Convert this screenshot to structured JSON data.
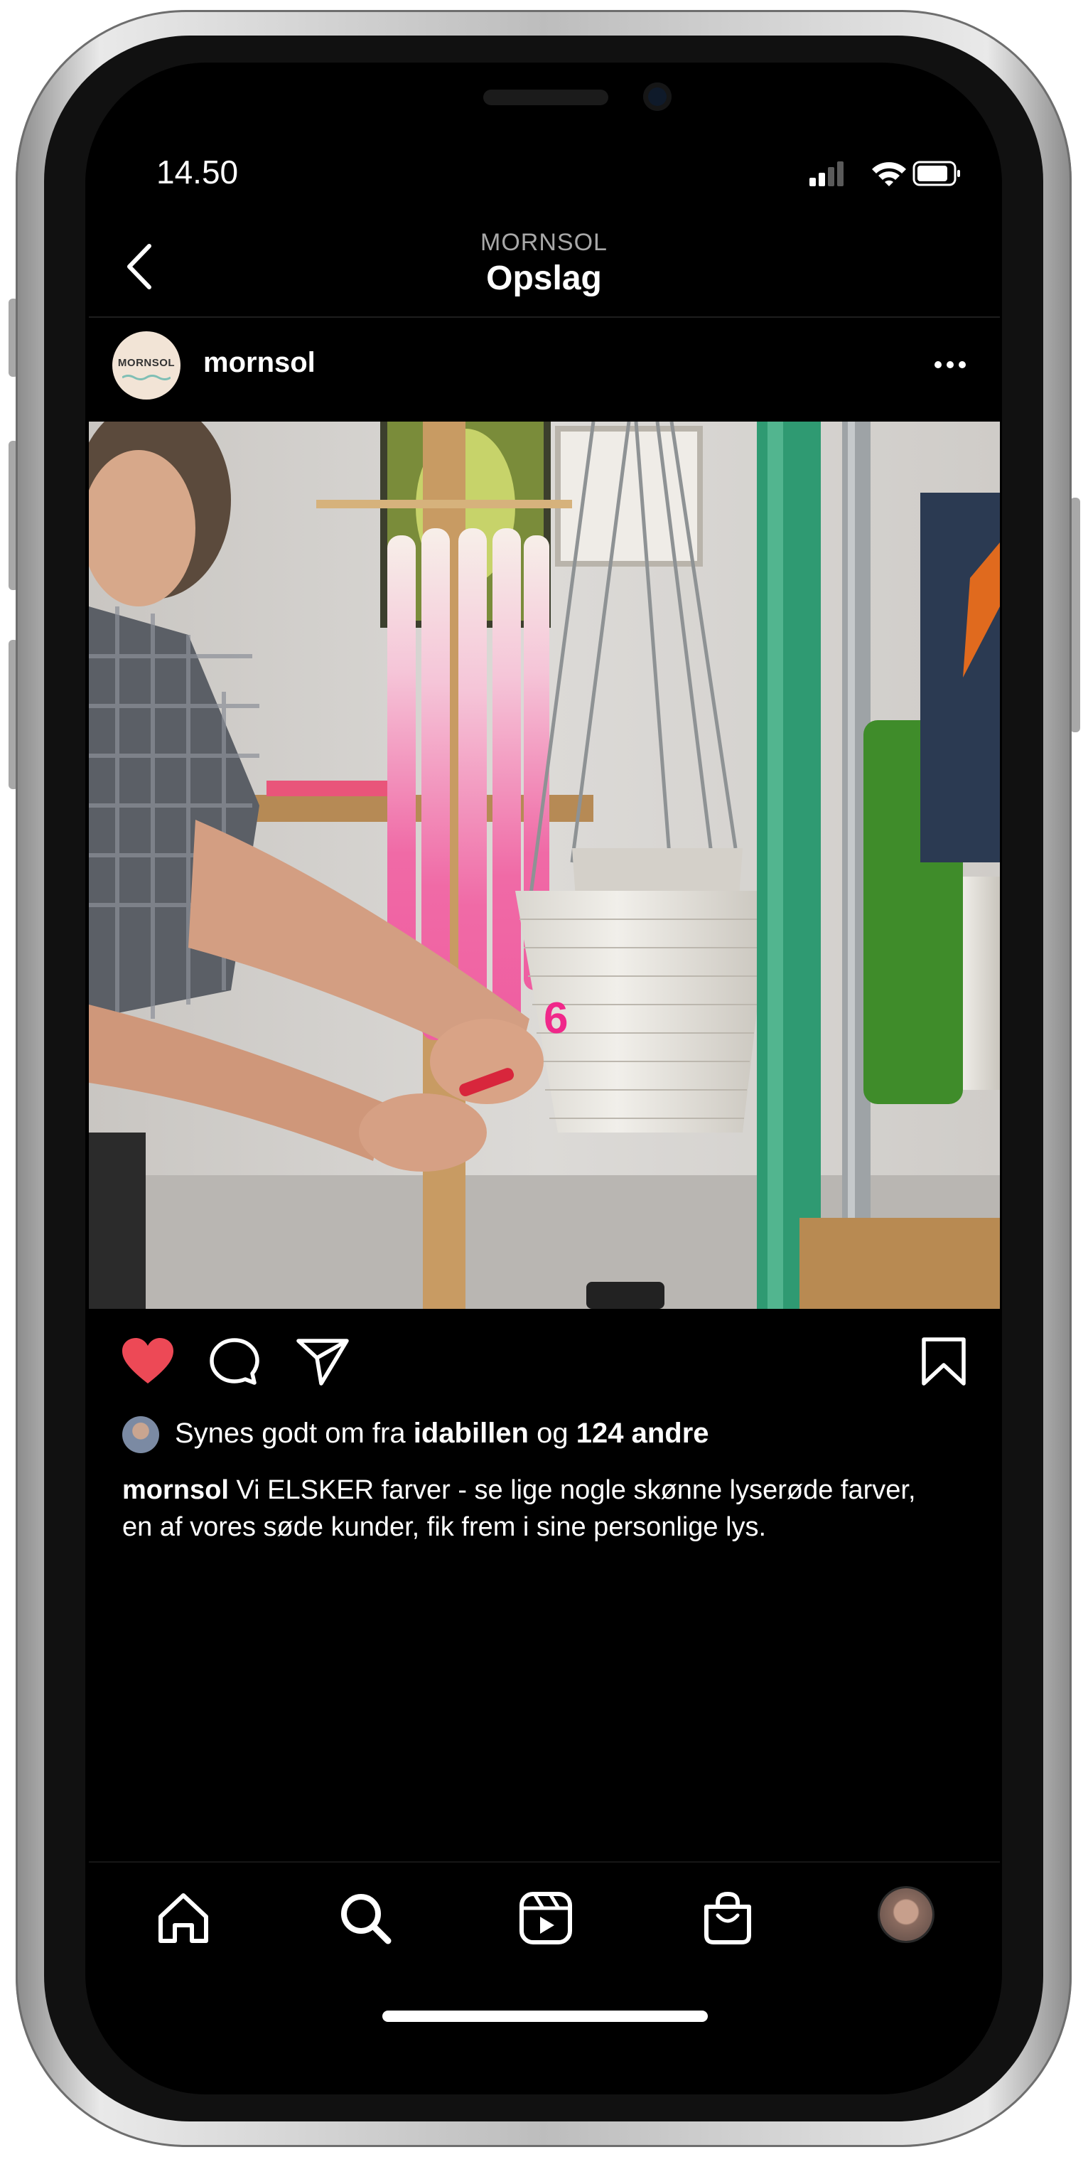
{
  "status_bar": {
    "time": "14.50"
  },
  "nav": {
    "account": "MORNSOL",
    "title": "Opslag"
  },
  "post": {
    "avatar_text": "MORNSOL",
    "username": "mornsol",
    "photo_number": "6",
    "likes": {
      "prefix": "Synes godt om fra",
      "user": "idabillen",
      "connector": "og",
      "others": "124 andre"
    },
    "caption": {
      "username": "mornsol",
      "text": "Vi ELSKER farver - se lige nogle skønne lyserøde farver, en af vores søde kunder, fik frem i sine personlige lys."
    },
    "liked": true
  },
  "icons": {
    "back": "chevron-left-icon",
    "more": "more-horizontal-icon",
    "like": "heart-icon",
    "comment": "comment-icon",
    "share": "paper-plane-icon",
    "save": "bookmark-icon",
    "home": "home-icon",
    "search": "search-icon",
    "reels": "reels-icon",
    "shop": "shopping-bag-icon"
  },
  "colors": {
    "like": "#ed4956",
    "background": "#000000",
    "text": "#ffffff",
    "secondary_text": "#a8a8a8",
    "candle_pink": "#f06aa6"
  }
}
